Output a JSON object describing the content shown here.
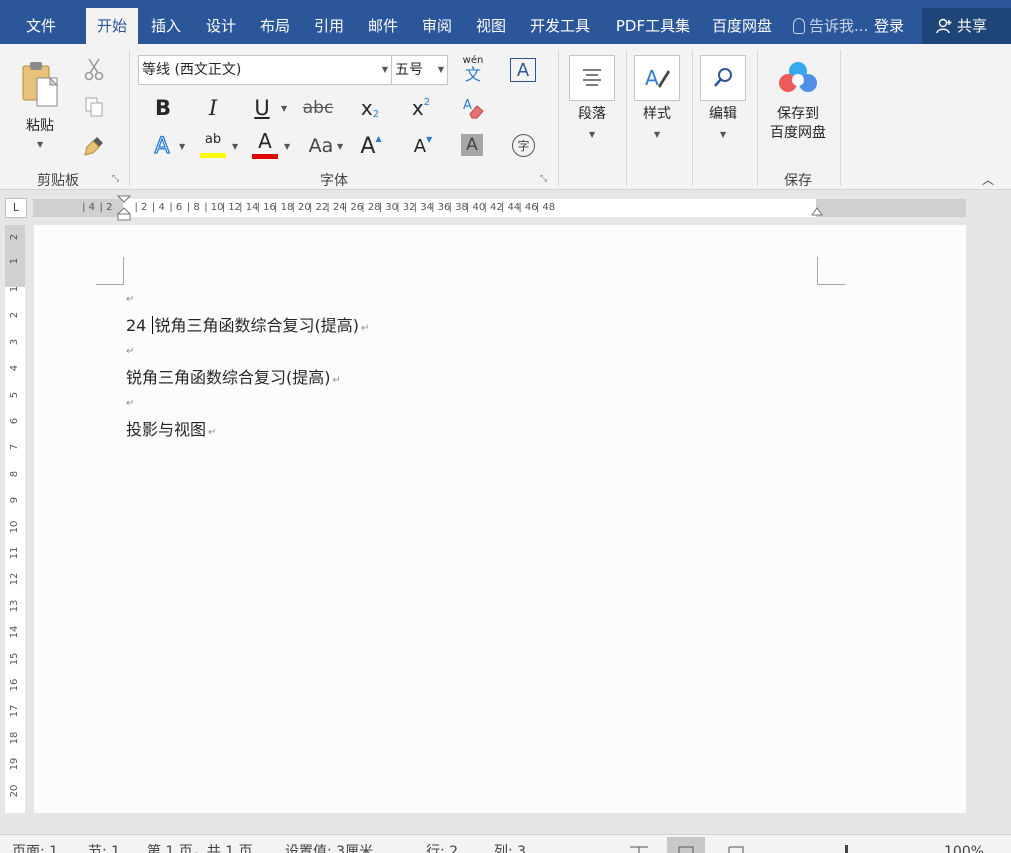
{
  "tabs": [
    {
      "label": "文件",
      "left": 0
    },
    {
      "label": "开始",
      "active": true
    },
    {
      "label": "插入"
    },
    {
      "label": "设计"
    },
    {
      "label": "布局"
    },
    {
      "label": "引用"
    },
    {
      "label": "邮件"
    },
    {
      "label": "审阅"
    },
    {
      "label": "视图"
    },
    {
      "label": "开发工具"
    },
    {
      "label": "PDF工具集"
    },
    {
      "label": "百度网盘"
    }
  ],
  "tell_me": "告诉我...",
  "login": "登录",
  "share": "共享",
  "clipboard": {
    "paste": "粘贴",
    "group": "剪贴板"
  },
  "font": {
    "name": "等线 (西文正文)",
    "size": "五号",
    "phonetic_top": "wén",
    "phonetic_bottom": "文",
    "bold": "B",
    "italic": "I",
    "underline": "U",
    "strike": "abc",
    "sub": "x",
    "sub_small": "2",
    "sup": "x",
    "sup_small": "2",
    "change_case": "Aa",
    "grow": "A",
    "shrink": "A",
    "shading": "A",
    "enclose": "字",
    "highlight": "ab",
    "color": "A",
    "border_char": "A",
    "effect": "A",
    "group": "字体"
  },
  "paragraph": {
    "label": "段落"
  },
  "styles": {
    "label": "样式"
  },
  "editing": {
    "label": "编辑"
  },
  "save": {
    "line1": "保存到",
    "line2": "百度网盘",
    "group": "保存"
  },
  "ruler": {
    "tab_selector": "L",
    "h_labels": [
      "4",
      "2",
      "2",
      "4",
      "6",
      "8",
      "10",
      "12",
      "14",
      "16",
      "18",
      "20",
      "22",
      "24",
      "26",
      "28",
      "30",
      "32",
      "34",
      "36",
      "38",
      "40",
      "42",
      "44",
      "46",
      "48"
    ],
    "v_labels": [
      "2",
      "1",
      "1",
      "2",
      "3",
      "4",
      "5",
      "6",
      "7",
      "8",
      "9",
      "10",
      "11",
      "12",
      "13",
      "14",
      "15",
      "16",
      "17",
      "18",
      "19",
      "20"
    ]
  },
  "document": {
    "paragraphs": [
      {
        "text": "",
        "empty": true
      },
      {
        "prefix": "24 ",
        "text": "锐角三角函数综合复习(提高)",
        "cursor": true
      },
      {
        "text": "",
        "empty": true
      },
      {
        "text": "锐角三角函数综合复习(提高)"
      },
      {
        "text": "",
        "empty": true
      },
      {
        "text": "投影与视图"
      }
    ],
    "para_mark": "↵"
  },
  "status": {
    "page": "页面: 1",
    "section": "节: 1",
    "pages": "第 1 页，共 1 页",
    "position": "设置值: 3厘米",
    "line": "行: 2",
    "column": "列: 3",
    "zoom": "100%"
  }
}
